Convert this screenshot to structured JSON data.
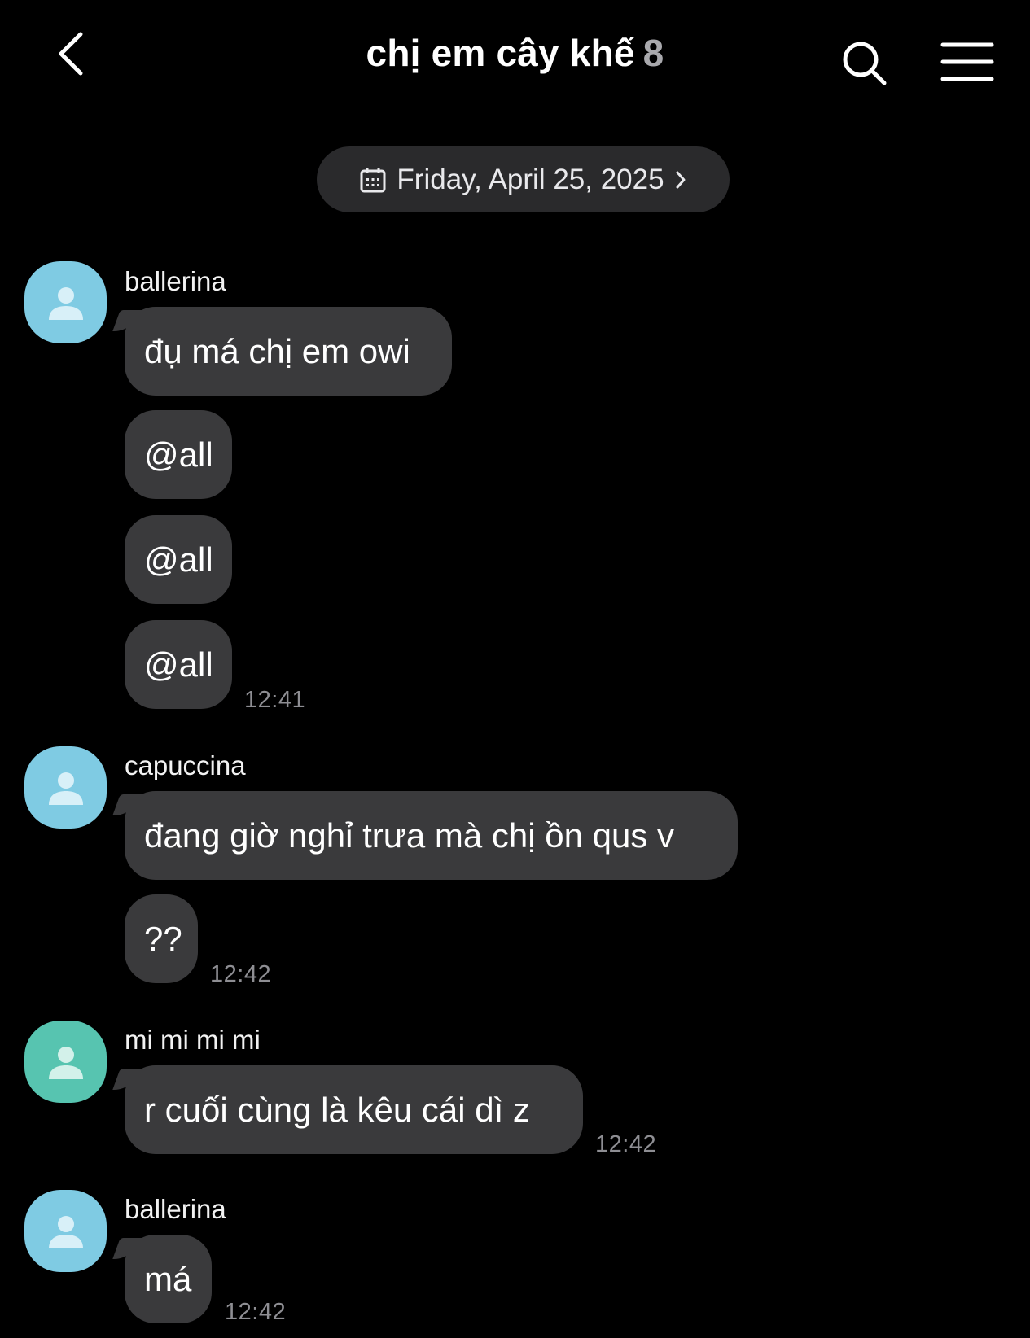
{
  "header": {
    "title": "chị em cây khế",
    "member_count": "8",
    "back_icon": "chevron-left-icon",
    "search_icon": "search-icon",
    "menu_icon": "hamburger-menu-icon"
  },
  "date_divider": {
    "label": "Friday, April 25, 2025",
    "icon": "calendar-icon",
    "chevron": "chevron-right-icon"
  },
  "messages": [
    {
      "sender": "ballerina",
      "avatar_color": "#7fcbe3",
      "bubbles": [
        "đụ má chị em owi",
        "@all",
        "@all",
        "@all"
      ],
      "time": "12:41"
    },
    {
      "sender": "capuccina",
      "avatar_color": "#7fcbe3",
      "bubbles": [
        "đang giờ nghỉ trưa mà chị ồn qus v",
        "??"
      ],
      "time": "12:42"
    },
    {
      "sender": "mi mi mi mi",
      "avatar_color": "#57c4b0",
      "bubbles": [
        "r cuối cùng là kêu cái dì z"
      ],
      "time": "12:42"
    },
    {
      "sender": "ballerina",
      "avatar_color": "#7fcbe3",
      "bubbles": [
        "má"
      ],
      "time": "12:42"
    }
  ]
}
